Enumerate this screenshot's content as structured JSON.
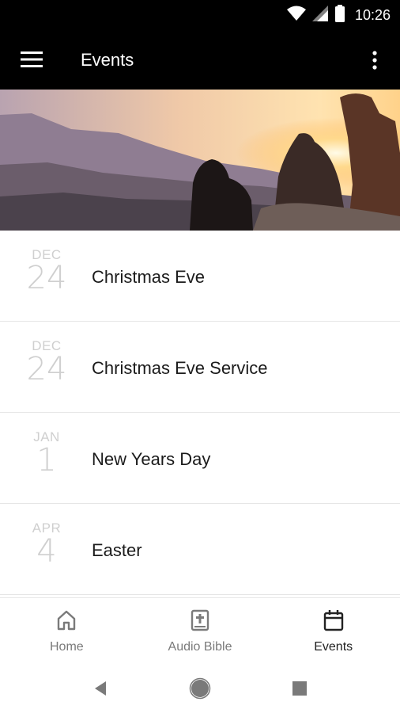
{
  "status_bar": {
    "time": "10:26",
    "icons": [
      "wifi-icon",
      "signal-icon",
      "battery-icon"
    ]
  },
  "app_bar": {
    "title": "Events",
    "menu_icon": "hamburger-menu-icon",
    "more_icon": "more-vert-icon",
    "background": "#000000"
  },
  "hero": {
    "image": "people-watching-sunset-over-mountains"
  },
  "events": [
    {
      "month": "DEC",
      "day": "24",
      "title": "Christmas Eve"
    },
    {
      "month": "DEC",
      "day": "24",
      "title": "Christmas Eve Service"
    },
    {
      "month": "JAN",
      "day": "1",
      "title": "New Years Day"
    },
    {
      "month": "APR",
      "day": "4",
      "title": "Easter"
    }
  ],
  "bottom_nav": {
    "items": [
      {
        "label": "Home",
        "icon": "home-icon",
        "active": false
      },
      {
        "label": "Audio Bible",
        "icon": "bible-icon",
        "active": false
      },
      {
        "label": "Events",
        "icon": "calendar-icon",
        "active": true
      }
    ]
  },
  "system_nav": {
    "icons": [
      "back-icon",
      "home-circle-icon",
      "recents-icon"
    ]
  },
  "colors": {
    "date_text": "#cfcfcf",
    "title_text": "#1b1b1b",
    "divider": "#e6e6e6",
    "nav_inactive": "#7a7a7a",
    "nav_active": "#222222"
  }
}
